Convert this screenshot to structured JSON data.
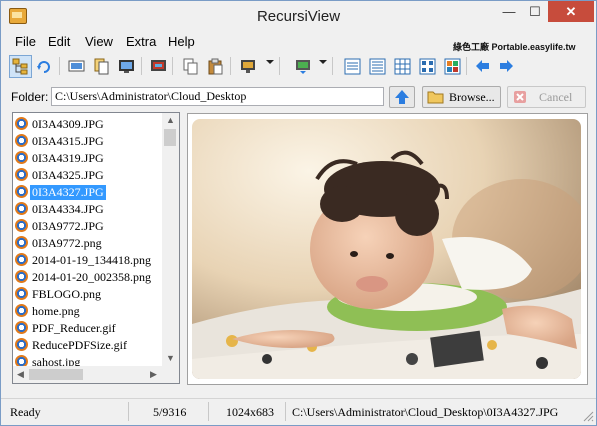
{
  "window": {
    "title": "RecursiView"
  },
  "menu": [
    "File",
    "Edit",
    "View",
    "Extra",
    "Help"
  ],
  "watermark": "綠色工廠 Portable.easylife.tw",
  "toolbar": {
    "icons": [
      "tree-view-icon",
      "refresh-icon",
      "slideshow-icon",
      "copy-file-icon",
      "screen-icon",
      "display-icon",
      "copy-icon",
      "paste-icon",
      "wallpaper-icon",
      "set-wallpaper-icon",
      "view-list-icon",
      "view-details-icon",
      "view-grid-icon",
      "view-thumbs-icon",
      "view-icons-icon",
      "back-arrow-icon",
      "forward-arrow-icon"
    ]
  },
  "folder": {
    "label": "Folder:",
    "path": "C:\\Users\\Administrator\\Cloud_Desktop",
    "browse_label": "Browse...",
    "cancel_label": "Cancel"
  },
  "files": [
    "0I3A4309.JPG",
    "0I3A4315.JPG",
    "0I3A4319.JPG",
    "0I3A4325.JPG",
    "0I3A4327.JPG",
    "0I3A4334.JPG",
    "0I3A9772.JPG",
    "0I3A9772.png",
    "2014-01-19_134418.png",
    "2014-01-20_002358.png",
    "FBLOGO.png",
    "home.png",
    "PDF_Reducer.gif",
    "ReducePDFSize.gif",
    "sahost.jpg"
  ],
  "selected_index": 4,
  "status": {
    "state": "Ready",
    "position": "5/9316",
    "dimensions": "1024x683",
    "filepath": "C:\\Users\\Administrator\\Cloud_Desktop\\0I3A4327.JPG"
  },
  "colors": {
    "selection": "#3399ff",
    "close_button": "#c74c3c",
    "accent_arrow": "#2b7de0"
  }
}
